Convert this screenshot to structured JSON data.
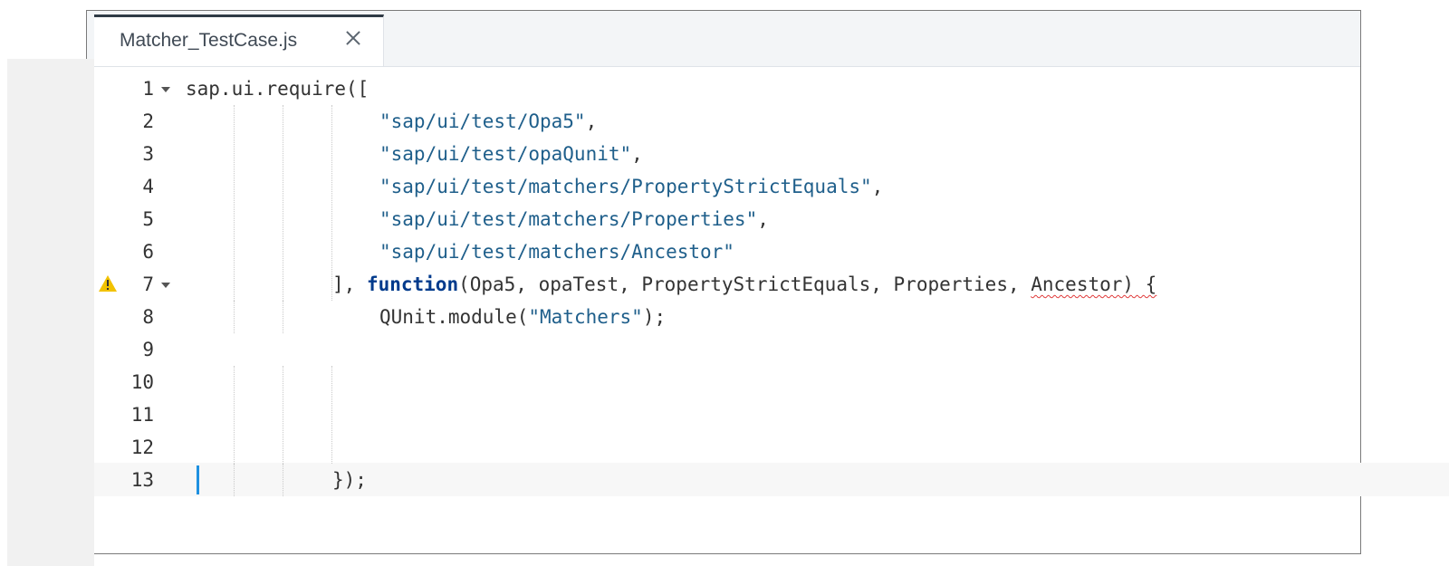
{
  "tab": {
    "title": "Matcher_TestCase.js"
  },
  "lines": [
    {
      "n": "1",
      "parts": [
        {
          "t": "sap.ui.require(["
        }
      ]
    },
    {
      "n": "2",
      "parts": [
        {
          "t": "\"sap/ui/test/Opa5\"",
          "c": "str"
        },
        {
          "t": ","
        }
      ]
    },
    {
      "n": "3",
      "parts": [
        {
          "t": "\"sap/ui/test/opaQunit\"",
          "c": "str"
        },
        {
          "t": ","
        }
      ]
    },
    {
      "n": "4",
      "parts": [
        {
          "t": "\"sap/ui/test/matchers/PropertyStrictEquals\"",
          "c": "str"
        },
        {
          "t": ","
        }
      ]
    },
    {
      "n": "5",
      "parts": [
        {
          "t": "\"sap/ui/test/matchers/Properties\"",
          "c": "str"
        },
        {
          "t": ","
        }
      ]
    },
    {
      "n": "6",
      "parts": [
        {
          "t": "\"sap/ui/test/matchers/Ancestor\"",
          "c": "str"
        }
      ]
    },
    {
      "n": "7",
      "parts": [
        {
          "t": "], "
        },
        {
          "t": "function",
          "c": "kw"
        },
        {
          "t": "(Opa5, opaTest, PropertyStrictEquals, Properties, "
        },
        {
          "t": "Ancestor) {",
          "c": "squiggle"
        }
      ]
    },
    {
      "n": "8",
      "parts": [
        {
          "t": "QUnit.module("
        },
        {
          "t": "\"Matchers\"",
          "c": "str"
        },
        {
          "t": ");"
        }
      ]
    },
    {
      "n": "9",
      "parts": []
    },
    {
      "n": "10",
      "parts": []
    },
    {
      "n": "11",
      "parts": []
    },
    {
      "n": "12",
      "parts": []
    },
    {
      "n": "13",
      "parts": [
        {
          "t": "});"
        }
      ]
    }
  ],
  "icons": {
    "warning": "warning-icon",
    "close": "close-icon",
    "fold": "fold-arrow-icon"
  },
  "colors": {
    "string": "#1f5f8b",
    "keyword": "#003a8c",
    "caret": "#1e90e0",
    "warning": "#f2c200"
  }
}
